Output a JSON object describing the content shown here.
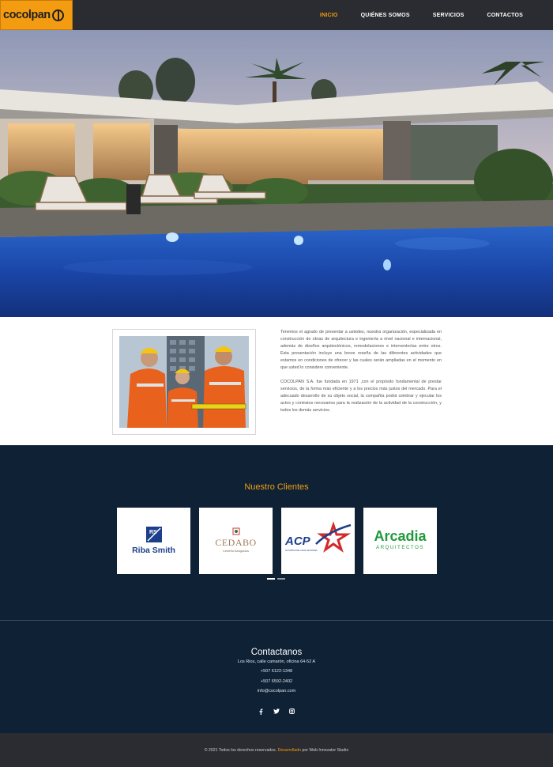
{
  "header": {
    "logo_text": "cocolpan",
    "nav": [
      {
        "label": "INICIO",
        "active": true
      },
      {
        "label": "QUIÉNES SOMOS",
        "active": false
      },
      {
        "label": "SERVICIOS",
        "active": false
      },
      {
        "label": "CONTACTOS",
        "active": false
      }
    ]
  },
  "about": {
    "paragraph1": "Tenemos el agrado de presentar a ustedes, nuestra organización, especializada en construcción de obras de arquitectura e ingeniería a nivel nacional e internacional, además de diseños arquitectónicos, remodelaciones e interventorías entre otros. Esta presentación incluye una breve reseña de las diferentes actividades que estamos en condiciones de ofrecer y las cuales serán ampliadas en el momento en que usted lo considere conveniente.",
    "paragraph2": "COCOLPAN S.A. fue fundada en 1971 ,con el propósito fundamental de prestar servicios, de la forma más eficiente y a los precios más justos del mercado. Para el adecuado desarrollo de su objeto social, la compañía podrá celebrar y ejecutar los actos y contratos necesarios para la realización de la actividad de la construcción, y todos los demás servicios."
  },
  "clients": {
    "title": "Nuestro Clientes",
    "logos": [
      {
        "name": "Riba Smith",
        "mark": "RS"
      },
      {
        "name": "CEDABO",
        "sub": "Cedeño Abogados"
      },
      {
        "name": "ACP",
        "sub": "AUTORIDAD DEL CANAL DE PANAMÁ"
      },
      {
        "name": "Arcadia",
        "sub": "ARQUITECTOS"
      }
    ]
  },
  "contact": {
    "title": "Contactanos",
    "address": "Los Rios, calle camarón, oficina 64-52 A",
    "phone1": "+507 6122-1348",
    "phone2": "+507 6592-2402",
    "email": "info@cocolpan.com"
  },
  "footer": {
    "prefix": "© 2021 Todos los derechos reservados.",
    "highlight": "Desarrollado",
    "suffix": "por Web Innovator Studio"
  },
  "colors": {
    "accent": "#f39c12",
    "dark_navy": "#0f2235",
    "header_bg": "#2a2c31"
  }
}
